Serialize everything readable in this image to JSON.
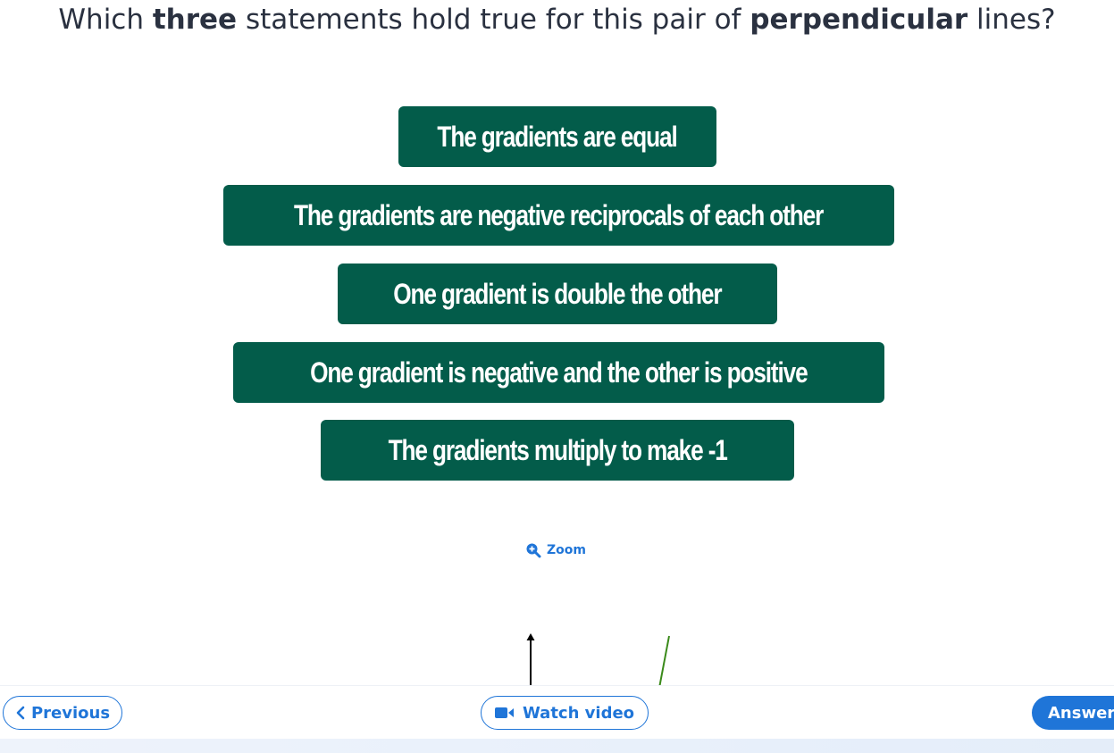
{
  "question": {
    "part1": "Which ",
    "bold1": "three",
    "part2": " statements hold true for this pair of ",
    "bold2": "perpendicular",
    "part3": " lines?"
  },
  "options": [
    "The gradients are equal",
    "The gradients are negative reciprocals of each other",
    "One gradient is double the other",
    "One gradient is negative and the other is positive",
    "The gradients multiply to make -1"
  ],
  "zoom": {
    "label": "Zoom",
    "icon": "zoom-in-icon"
  },
  "footer": {
    "previous_label": "Previous",
    "video_label": "Watch video",
    "answer_label": "Answer"
  },
  "colors": {
    "option_bg": "#035c4a",
    "accent": "#1f75d8",
    "question_text": "#2a3140",
    "line_green": "#3a8a1a"
  }
}
